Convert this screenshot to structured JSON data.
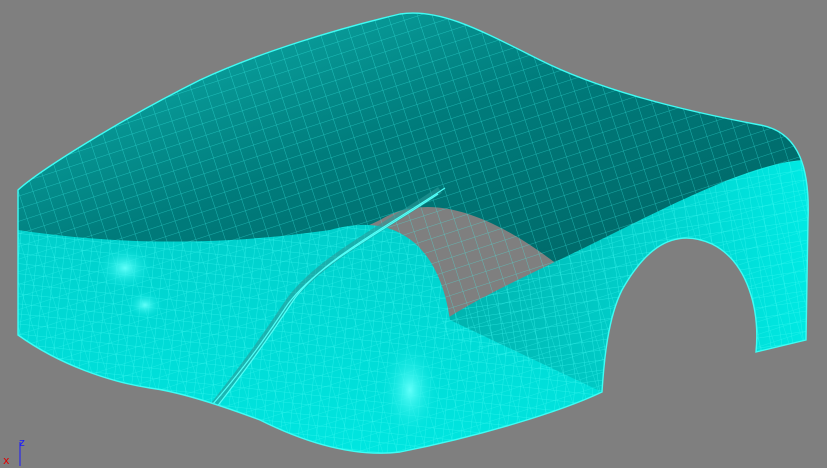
{
  "viewport": {
    "background_color": "#7f7f7f",
    "mesh_fill_color": "#00d6d2",
    "mesh_wire_color": "#3ffcf4",
    "mesh_shadow_color": "#006a6a",
    "highlight_color": "#39fff6"
  },
  "axis_gizmo": {
    "z_label": "z",
    "x_label": "x",
    "z_color": "#1a1aff",
    "x_color": "#e00000"
  }
}
